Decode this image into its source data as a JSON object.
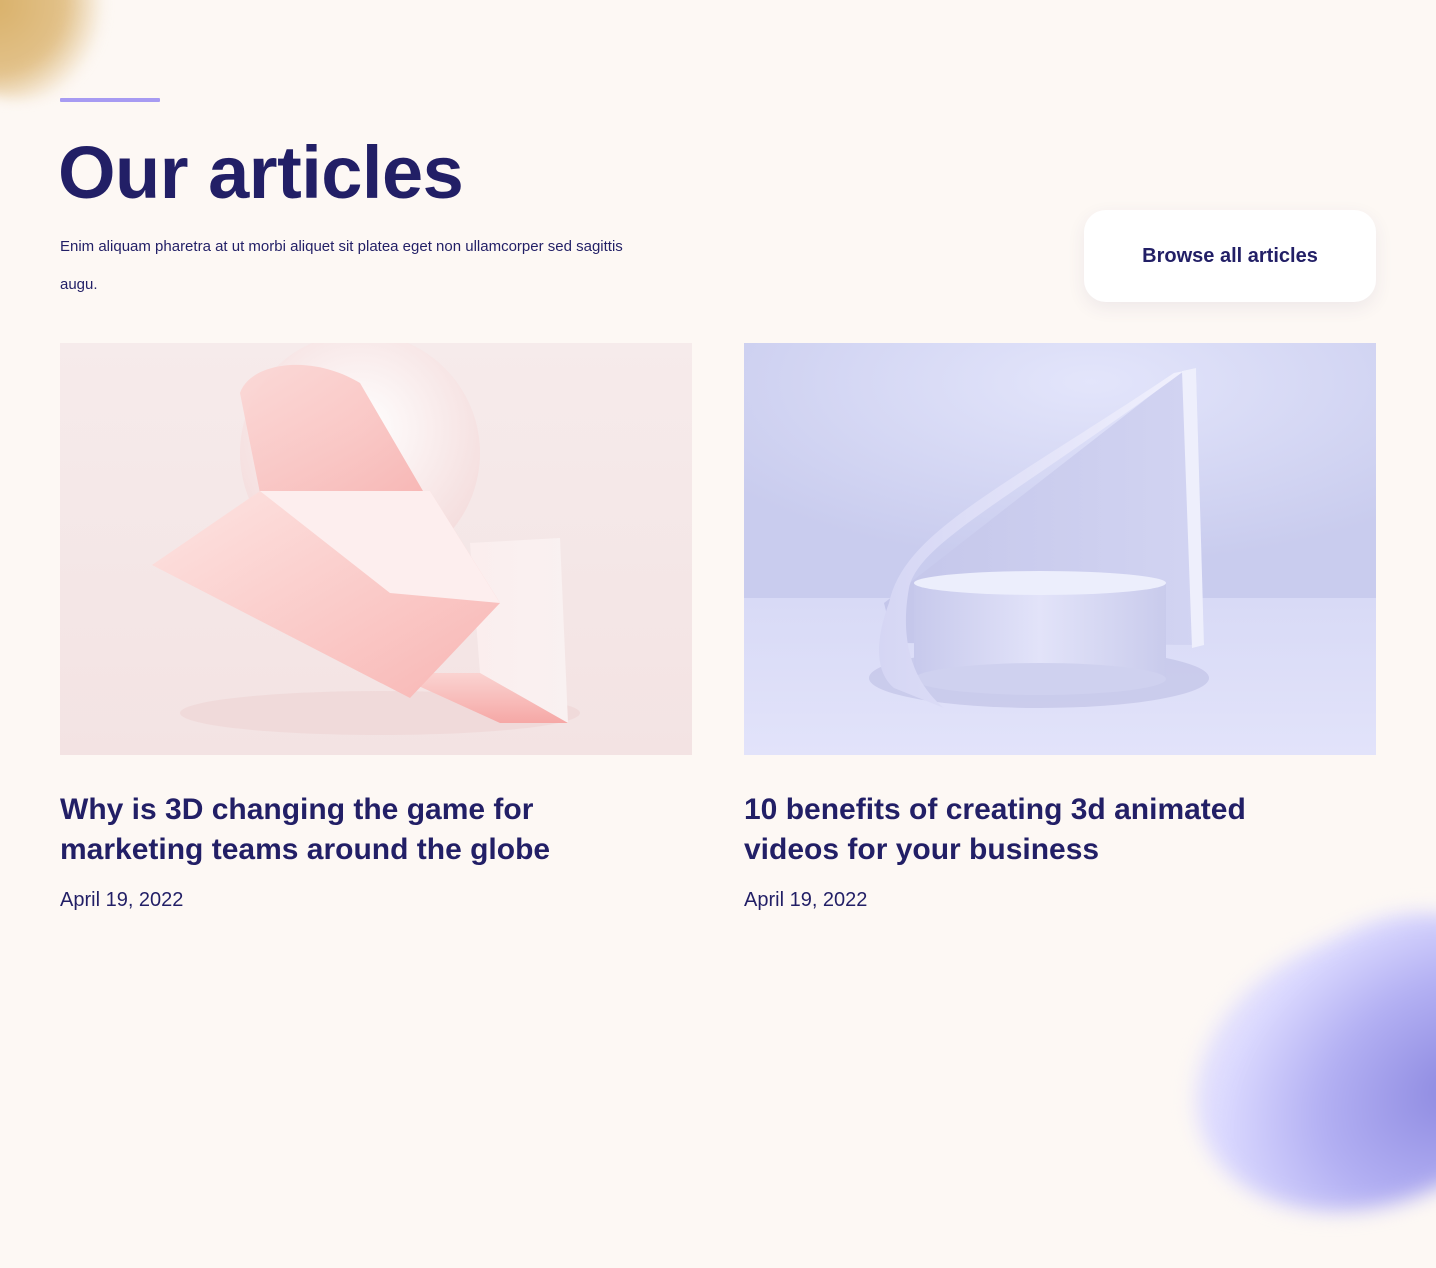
{
  "header": {
    "title": "Our articles",
    "description": "Enim aliquam pharetra at ut morbi aliquet sit platea eget non ullamcorper sed sagittis augu.",
    "browse_button": "Browse all articles"
  },
  "articles": [
    {
      "title": "Why is 3D changing the game for marketing teams around the globe",
      "date": "April 19, 2022",
      "image": "pink-3d-geometric-shapes"
    },
    {
      "title": "10 benefits of creating 3d animated videos for your business",
      "date": "April 19, 2022",
      "image": "lavender-3d-podium-with-curved-wall"
    }
  ],
  "colors": {
    "background": "#fdf8f4",
    "text": "#221f66",
    "accent": "#a79bf2",
    "button_background": "#ffffff"
  }
}
